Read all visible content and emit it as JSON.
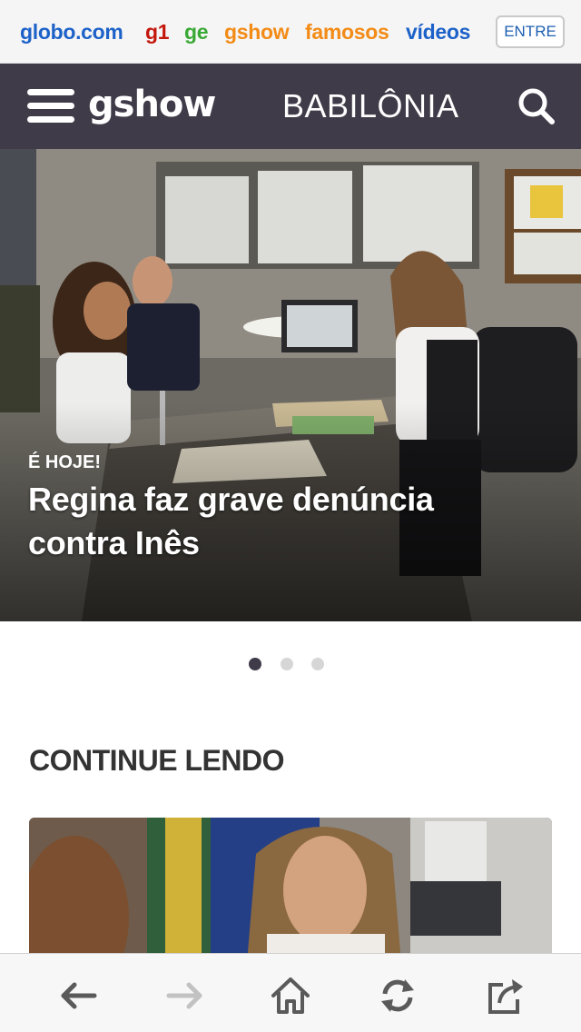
{
  "portal": {
    "links": [
      "globo.com",
      "g1",
      "ge",
      "gshow",
      "famosos",
      "vídeos"
    ],
    "login_label": "ENTRE"
  },
  "header": {
    "brand": "gshow",
    "show_title": "BABILÔNIA",
    "menu_icon": "hamburger-menu-icon",
    "search_icon": "search-icon",
    "background_color": "#403b48"
  },
  "hero": {
    "tag": "É HOJE!",
    "headline": "Regina faz grave denúncia contra Inês",
    "slide_current": 1,
    "slide_count": 3
  },
  "continue_reading": {
    "heading": "CONTINUE LENDO"
  },
  "browser_toolbar": {
    "icons": [
      "back-arrow-icon",
      "forward-arrow-icon",
      "home-icon",
      "refresh-icon",
      "share-icon"
    ],
    "forward_enabled": false
  },
  "colors": {
    "globo_blue": "#1d62c9",
    "g1_red": "#c4170c",
    "ge_green": "#39a935",
    "gshow_orange": "#f38b17",
    "dot_active": "#3f3b48",
    "dot_inactive": "#d6d6d6"
  }
}
